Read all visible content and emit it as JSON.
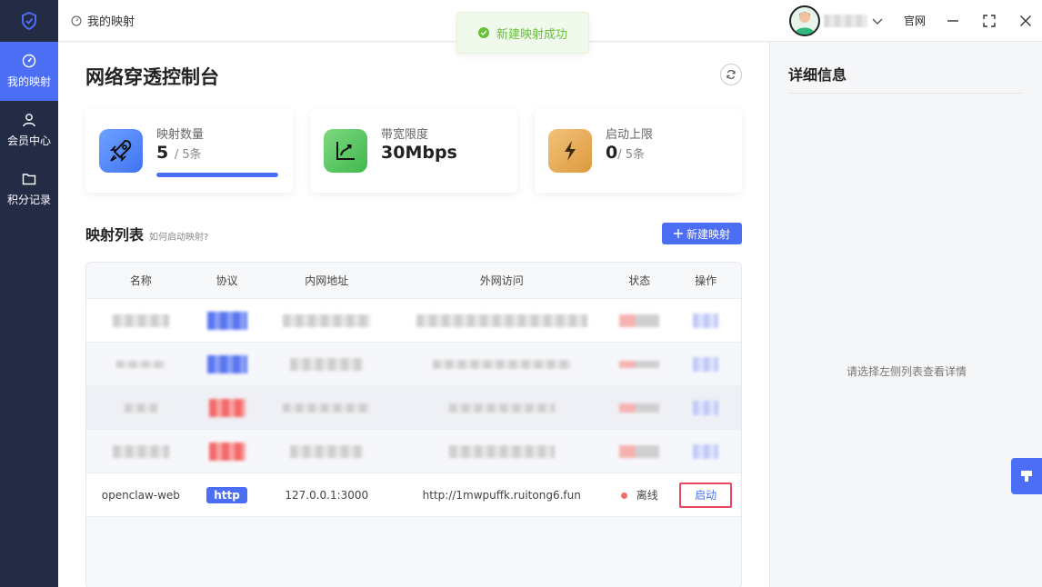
{
  "sidebar": {
    "items": [
      {
        "label": "我的映射",
        "icon": "gauge-icon",
        "active": true
      },
      {
        "label": "会员中心",
        "icon": "user-icon",
        "active": false
      },
      {
        "label": "积分记录",
        "icon": "folder-icon",
        "active": false
      }
    ]
  },
  "topbar": {
    "breadcrumb": "我的映射",
    "official_site": "官网"
  },
  "toast": {
    "message": "新建映射成功",
    "color": "#67c23a"
  },
  "main": {
    "title": "网络穿透控制台",
    "stats": {
      "mappings": {
        "label": "映射数量",
        "value": "5",
        "unit": "/ 5条",
        "progress": 1.0
      },
      "bandwidth": {
        "label": "带宽限度",
        "value": "30Mbps"
      },
      "starts": {
        "label": "启动上限",
        "value": "0",
        "unit": "/ 5条"
      }
    },
    "list_title": "映射列表",
    "list_hint": "如何启动映射?",
    "new_button": "新建映射",
    "table": {
      "headers": [
        "名称",
        "协议",
        "内网地址",
        "外网访问",
        "状态",
        "操作"
      ],
      "visible_row": {
        "name": "openclaw-web",
        "protocol": "http",
        "internal": "127.0.0.1:3000",
        "external": "http://1mwpuffk.ruitong6.fun",
        "status": "离线",
        "action": "启动"
      }
    }
  },
  "detail": {
    "title": "详细信息",
    "empty": "请选择左侧列表查看详情"
  },
  "colors": {
    "accent": "#4c6ef5",
    "sidebar": "#232b45",
    "offline": "#f56c6c"
  }
}
